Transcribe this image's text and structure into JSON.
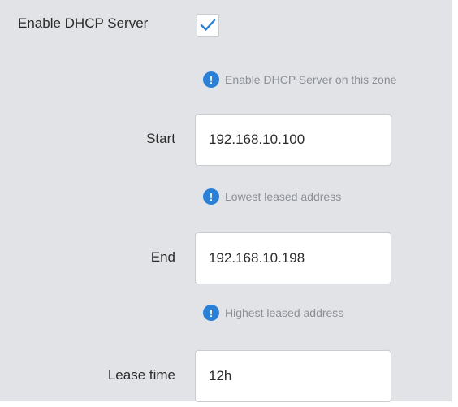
{
  "dhcp": {
    "enable_label": "Enable DHCP Server",
    "enable_checked": true,
    "enable_hint": "Enable DHCP Server on this zone",
    "start_label": "Start",
    "start_value": "192.168.10.100",
    "start_hint": "Lowest leased address",
    "end_label": "End",
    "end_value": "192.168.10.198",
    "end_hint": "Highest leased address",
    "lease_label": "Lease time",
    "lease_value": "12h"
  },
  "colors": {
    "panel_bg": "#e2e3e6",
    "accent": "#2a80d6",
    "hint_text": "#8b8f96"
  },
  "icons": {
    "check": "check-icon",
    "info": "info-icon"
  }
}
